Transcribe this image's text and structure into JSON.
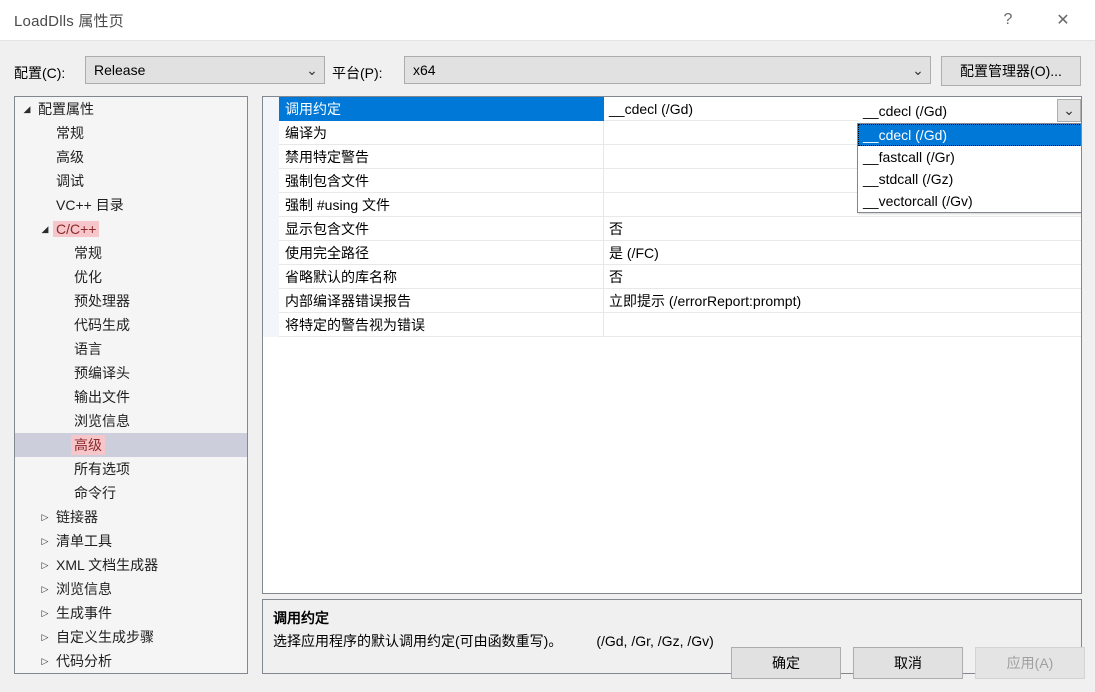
{
  "window": {
    "title": "LoadDlls 属性页",
    "help_glyph": "?",
    "close_glyph": "✕"
  },
  "config_row": {
    "configuration_label": "配置(C):",
    "configuration_value": "Release",
    "platform_label": "平台(P):",
    "platform_value": "x64",
    "config_manager_button": "配置管理器(O)...",
    "arrow_glyph": "⌄"
  },
  "tree": {
    "items": [
      {
        "label": "配置属性",
        "indent": 0,
        "arrow": "expanded",
        "selected": false,
        "highlight": false
      },
      {
        "label": "常规",
        "indent": 1,
        "arrow": "none",
        "selected": false,
        "highlight": false
      },
      {
        "label": "高级",
        "indent": 1,
        "arrow": "none",
        "selected": false,
        "highlight": false
      },
      {
        "label": "调试",
        "indent": 1,
        "arrow": "none",
        "selected": false,
        "highlight": false
      },
      {
        "label": "VC++ 目录",
        "indent": 1,
        "arrow": "none",
        "selected": false,
        "highlight": false
      },
      {
        "label": "C/C++",
        "indent": 1,
        "arrow": "expanded",
        "selected": false,
        "highlight": true
      },
      {
        "label": "常规",
        "indent": 2,
        "arrow": "none",
        "selected": false,
        "highlight": false
      },
      {
        "label": "优化",
        "indent": 2,
        "arrow": "none",
        "selected": false,
        "highlight": false
      },
      {
        "label": "预处理器",
        "indent": 2,
        "arrow": "none",
        "selected": false,
        "highlight": false
      },
      {
        "label": "代码生成",
        "indent": 2,
        "arrow": "none",
        "selected": false,
        "highlight": false
      },
      {
        "label": "语言",
        "indent": 2,
        "arrow": "none",
        "selected": false,
        "highlight": false
      },
      {
        "label": "预编译头",
        "indent": 2,
        "arrow": "none",
        "selected": false,
        "highlight": false
      },
      {
        "label": "输出文件",
        "indent": 2,
        "arrow": "none",
        "selected": false,
        "highlight": false
      },
      {
        "label": "浏览信息",
        "indent": 2,
        "arrow": "none",
        "selected": false,
        "highlight": false
      },
      {
        "label": "高级",
        "indent": 2,
        "arrow": "none",
        "selected": true,
        "highlight": true
      },
      {
        "label": "所有选项",
        "indent": 2,
        "arrow": "none",
        "selected": false,
        "highlight": false
      },
      {
        "label": "命令行",
        "indent": 2,
        "arrow": "none",
        "selected": false,
        "highlight": false
      },
      {
        "label": "链接器",
        "indent": 1,
        "arrow": "collapsed",
        "selected": false,
        "highlight": false
      },
      {
        "label": "清单工具",
        "indent": 1,
        "arrow": "collapsed",
        "selected": false,
        "highlight": false
      },
      {
        "label": "XML 文档生成器",
        "indent": 1,
        "arrow": "collapsed",
        "selected": false,
        "highlight": false
      },
      {
        "label": "浏览信息",
        "indent": 1,
        "arrow": "collapsed",
        "selected": false,
        "highlight": false
      },
      {
        "label": "生成事件",
        "indent": 1,
        "arrow": "collapsed",
        "selected": false,
        "highlight": false
      },
      {
        "label": "自定义生成步骤",
        "indent": 1,
        "arrow": "collapsed",
        "selected": false,
        "highlight": false
      },
      {
        "label": "代码分析",
        "indent": 1,
        "arrow": "collapsed",
        "selected": false,
        "highlight": false
      }
    ],
    "arrow_expanded": "◢",
    "arrow_collapsed": "▷"
  },
  "grid": {
    "rows": [
      {
        "name": "调用约定",
        "value": "__cdecl (/Gd)",
        "selected": true
      },
      {
        "name": "编译为",
        "value": "",
        "selected": false
      },
      {
        "name": "禁用特定警告",
        "value": "",
        "selected": false
      },
      {
        "name": "强制包含文件",
        "value": "",
        "selected": false
      },
      {
        "name": "强制 #using 文件",
        "value": "",
        "selected": false
      },
      {
        "name": "显示包含文件",
        "value": "否",
        "selected": false
      },
      {
        "name": "使用完全路径",
        "value": "是 (/FC)",
        "selected": false
      },
      {
        "name": "省略默认的库名称",
        "value": "否",
        "selected": false
      },
      {
        "name": "内部编译器错误报告",
        "value": "立即提示 (/errorReport:prompt)",
        "selected": false
      },
      {
        "name": "将特定的警告视为错误",
        "value": "",
        "selected": false
      }
    ]
  },
  "editor": {
    "value": "__cdecl (/Gd)",
    "arrow_glyph": "⌄",
    "options": [
      {
        "label": "__cdecl (/Gd)",
        "selected": true
      },
      {
        "label": "__fastcall (/Gr)",
        "selected": false
      },
      {
        "label": "__stdcall (/Gz)",
        "selected": false
      },
      {
        "label": "__vectorcall (/Gv)",
        "selected": false
      }
    ]
  },
  "description": {
    "title": "调用约定",
    "text": "选择应用程序的默认调用约定(可由函数重写)。",
    "flags": "(/Gd, /Gr, /Gz, /Gv)"
  },
  "footer": {
    "ok": "确定",
    "cancel": "取消",
    "apply": "应用(A)"
  },
  "colors": {
    "accent": "#0078d7",
    "tree_selection": "#cdcedb",
    "highlight_pink": "#f7c6ca",
    "highlight_text": "#8b2a2a",
    "dialog_bg": "#f0f0f0",
    "control_bg": "#e1e1e1"
  }
}
